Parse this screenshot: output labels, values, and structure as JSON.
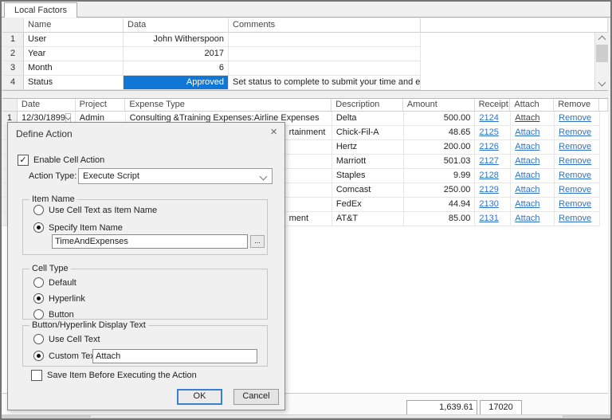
{
  "window": {
    "tab_label": "Local Factors"
  },
  "icons": {
    "close": "×",
    "check": "✓"
  },
  "colors": {
    "status_highlight": "#1177d7",
    "hyperlink": "#2f73c9"
  },
  "local_factors_grid": {
    "columns": [
      "Name",
      "Data",
      "Comments"
    ],
    "rows": [
      {
        "num": "1",
        "name": "User",
        "data": "John Witherspoon",
        "comments": ""
      },
      {
        "num": "2",
        "name": "Year",
        "data": "2017",
        "comments": ""
      },
      {
        "num": "3",
        "name": "Month",
        "data": "6",
        "comments": ""
      },
      {
        "num": "4",
        "name": "Status",
        "data": "Approved",
        "comments": "Set status to complete to submit your time and expenses."
      }
    ]
  },
  "expense_grid": {
    "columns": [
      "Date",
      "Project",
      "Expense Type",
      "Description",
      "Amount",
      "Receipt",
      "Attach",
      "Remove"
    ],
    "rows": [
      {
        "num": "1",
        "date": "12/30/1899",
        "project": "Admin",
        "expense_type": "Consulting &Training Expenses:Airline Expenses",
        "description": "Delta",
        "amount": "500.00",
        "receipt": "2124",
        "attach": "Attach",
        "remove": "Remove"
      },
      {
        "expense_type_fragment": "rtainment",
        "description": "Chick-Fil-A",
        "amount": "48.65",
        "receipt": "2125",
        "attach": "Attach",
        "remove": "Remove"
      },
      {
        "description": "Hertz",
        "amount": "200.00",
        "receipt": "2126",
        "attach": "Attach",
        "remove": "Remove"
      },
      {
        "description": "Marriott",
        "amount": "501.03",
        "receipt": "2127",
        "attach": "Attach",
        "remove": "Remove"
      },
      {
        "description": "Staples",
        "amount": "9.99",
        "receipt": "2128",
        "attach": "Attach",
        "remove": "Remove"
      },
      {
        "description": "Comcast",
        "amount": "250.00",
        "receipt": "2129",
        "attach": "Attach",
        "remove": "Remove"
      },
      {
        "description": "FedEx",
        "amount": "44.94",
        "receipt": "2130",
        "attach": "Attach",
        "remove": "Remove"
      },
      {
        "expense_type_fragment": "ment",
        "description": "AT&T",
        "amount": "85.00",
        "receipt": "2131",
        "attach": "Attach",
        "remove": "Remove"
      }
    ],
    "totals": {
      "amount_total": "1,639.61",
      "receipt_total": "17020"
    }
  },
  "dialog": {
    "title": "Define Action",
    "enable_cell_action": {
      "label": "Enable Cell Action",
      "checked": true
    },
    "action_type": {
      "label": "Action Type:",
      "value": "Execute Script"
    },
    "item_name": {
      "title": "Item Name",
      "use_cell_text": {
        "label": "Use Cell Text as Item Name",
        "selected": false
      },
      "specify": {
        "label": "Specify Item Name",
        "selected": true
      },
      "value": "TimeAndExpenses",
      "browse_label": "..."
    },
    "cell_type": {
      "title": "Cell Type",
      "default": {
        "label": "Default",
        "selected": false
      },
      "hyperlink": {
        "label": "Hyperlink",
        "selected": true
      },
      "button": {
        "label": "Button",
        "selected": false
      }
    },
    "display_text": {
      "title": "Button/Hyperlink Display Text",
      "use_cell_text": {
        "label": "Use Cell Text",
        "selected": false
      },
      "custom": {
        "label": "Custom Text",
        "selected": true,
        "value": "Attach"
      }
    },
    "save_before": {
      "label": "Save Item Before Executing the Action",
      "checked": false
    },
    "ok_label": "OK",
    "cancel_label": "Cancel"
  }
}
